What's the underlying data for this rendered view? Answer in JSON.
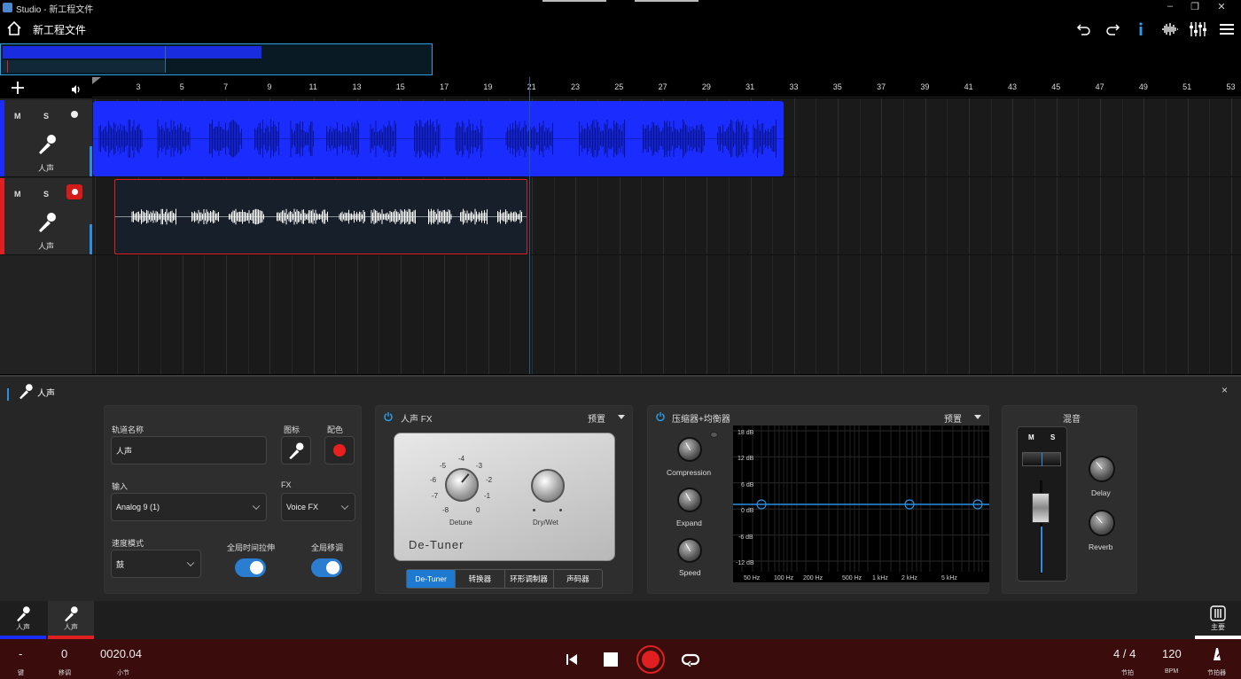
{
  "window": {
    "title": "Studio - 新工程文件"
  },
  "header": {
    "project_name": "新工程文件"
  },
  "ruler": {
    "ticks": [
      "3",
      "5",
      "7",
      "9",
      "11",
      "13",
      "15",
      "17",
      "19",
      "21",
      "23",
      "25",
      "27",
      "29",
      "31",
      "33",
      "35",
      "37",
      "39",
      "41",
      "43",
      "45",
      "47",
      "49",
      "51",
      "53"
    ]
  },
  "tracks": [
    {
      "name": "人声",
      "mute": "M",
      "solo": "S",
      "color": "#1a2cff",
      "record_armed": false
    },
    {
      "name": "人声",
      "mute": "M",
      "solo": "S",
      "color": "#e02020",
      "record_armed": true
    }
  ],
  "detail": {
    "title": "人声",
    "close": "×",
    "track_settings": {
      "name_label": "轨道名称",
      "name_value": "人声",
      "icon_label": "图标",
      "color_label": "配色",
      "color_value": "#e82020",
      "input_label": "输入",
      "input_value": "Analog 9 (1)",
      "fx_label": "FX",
      "fx_value": "Voice FX",
      "speed_label": "速度模式",
      "speed_value": "鼓",
      "stretch_label": "全局时间拉伸",
      "stretch_on": true,
      "transpose_label": "全局移调",
      "transpose_on": true
    },
    "vocal_fx": {
      "title": "人声 FX",
      "preset": "预置",
      "device_name": "De-Tuner",
      "detune_label": "Detune",
      "detune_scale": [
        "-4",
        "-5",
        "-3",
        "-6",
        "-2",
        "-7",
        "-1",
        "-8",
        "0"
      ],
      "drywet_label": "Dry/Wet",
      "tabs": [
        "De-Tuner",
        "转换器",
        "环形调制器",
        "声码器"
      ],
      "active_tab": 0
    },
    "comp_eq": {
      "title": "压缩器+均衡器",
      "preset": "预置",
      "knobs": [
        "Compression",
        "Expand",
        "Speed"
      ],
      "db_labels": [
        "18 dB",
        "12 dB",
        "6 dB",
        "0 dB",
        "-6 dB",
        "-12 dB"
      ],
      "freq_labels": [
        "50 Hz",
        "100 Hz",
        "200 Hz",
        "500 Hz",
        "1 kHz",
        "2 kHz",
        "5 kHz"
      ]
    },
    "mix": {
      "title": "混音",
      "mute": "M",
      "solo": "S",
      "knobs": [
        "Delay",
        "Reverb"
      ]
    }
  },
  "footer_tabs": [
    {
      "label": "人声",
      "color": "#1a2cff"
    },
    {
      "label": "人声",
      "color": "#e02020"
    }
  ],
  "main_tab": {
    "label": "主要"
  },
  "transport": {
    "key_value": "-",
    "key_label": "键",
    "transpose_value": "0",
    "transpose_label": "移调",
    "bar_value": "0020.04",
    "bar_label": "小节",
    "time_sig_value": "4 / 4",
    "time_sig_label": "节拍",
    "bpm_value": "120",
    "bpm_label": "BPM",
    "metronome_label": "节拍器"
  }
}
